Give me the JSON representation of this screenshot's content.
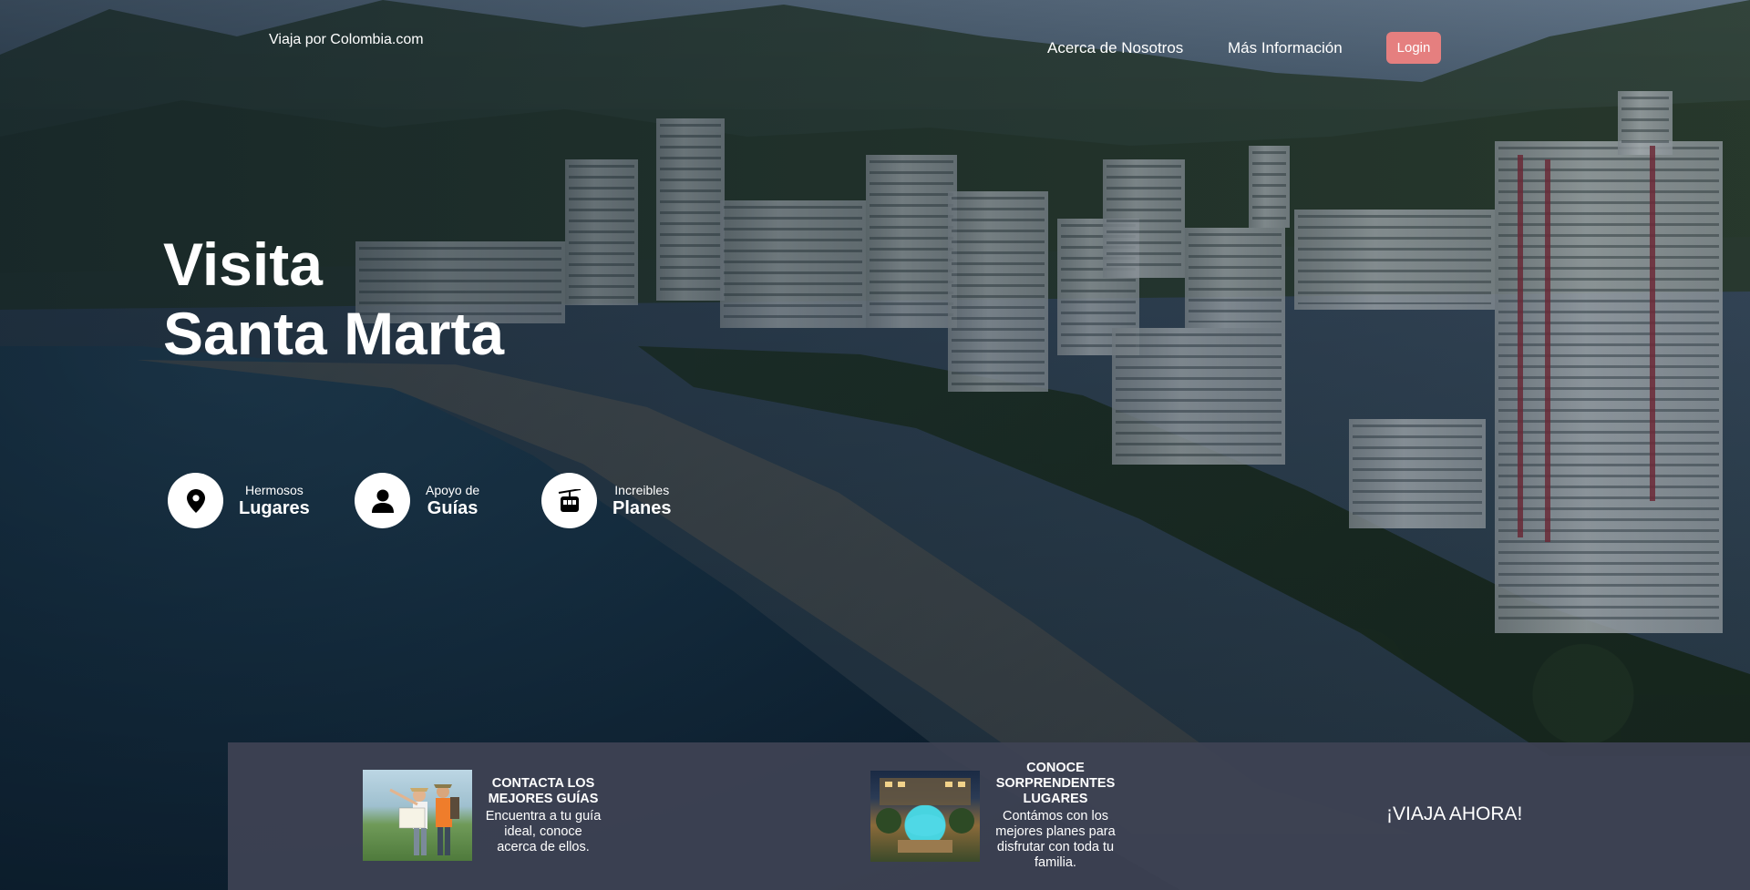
{
  "nav": {
    "brand": "Viaja por Colombia.com",
    "links": [
      {
        "label": "Acerca de Nosotros"
      },
      {
        "label": "Más Información"
      }
    ],
    "login_label": "Login"
  },
  "hero": {
    "title_line1": "Visita",
    "title_line2": "Santa Marta"
  },
  "features": [
    {
      "small": "Hermosos",
      "big": "Lugares",
      "icon": "location-pin-icon"
    },
    {
      "small": "Apoyo de",
      "big": "Guías",
      "icon": "person-icon"
    },
    {
      "small": "Increibles",
      "big": "Planes",
      "icon": "cable-car-icon"
    }
  ],
  "strip": {
    "cards": [
      {
        "title": "CONTACTA LOS MEJORES GUÍAS",
        "description": "Encuentra a tu guía ideal, conoce acerca de ellos."
      },
      {
        "title": "CONOCE SORPRENDENTES LUGARES",
        "description": "Contámos con los mejores planes para disfrutar con toda tu familia."
      }
    ],
    "cta_label": "¡VIAJA AHORA!"
  },
  "colors": {
    "login_button": "#e57f7f",
    "strip_background": "#3e4354",
    "text": "#ffffff"
  }
}
